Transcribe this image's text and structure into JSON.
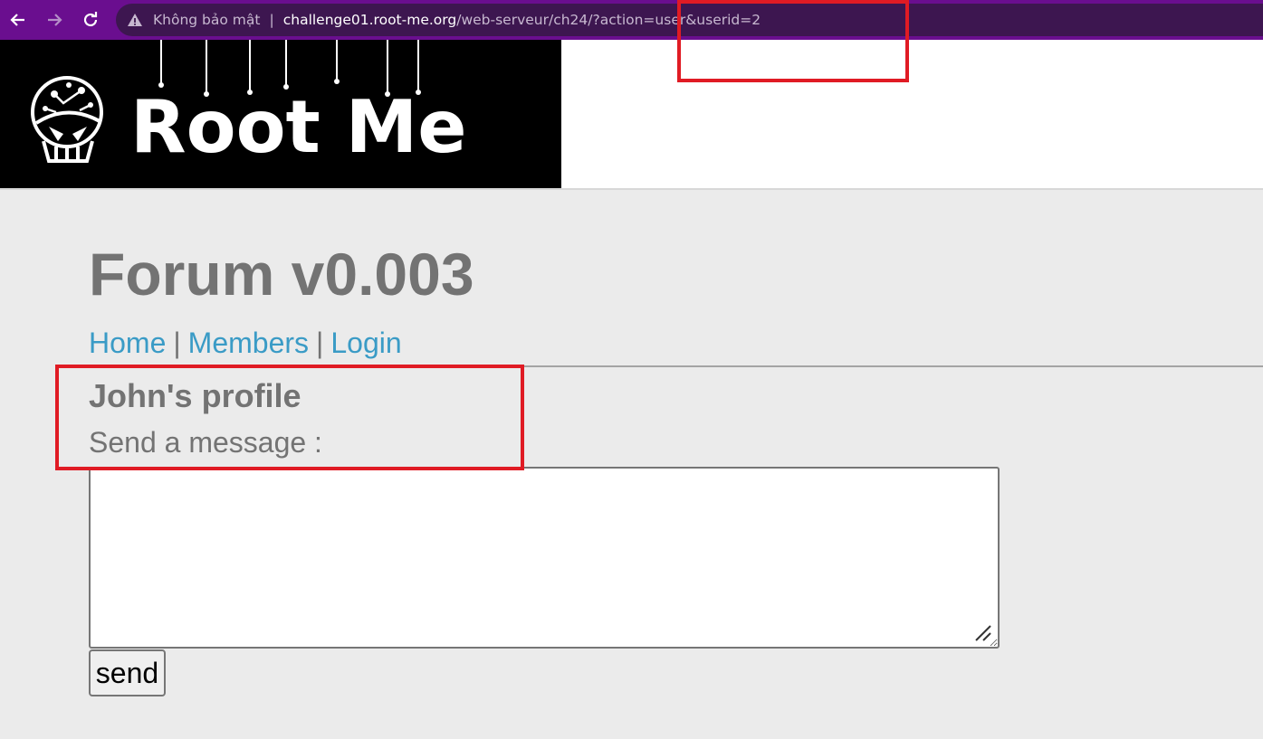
{
  "browser": {
    "security_label": "Không bảo mật",
    "url_host": "challenge01.root-me.org",
    "url_path": "/web-serveur/ch24/?action=user&userid=2"
  },
  "site": {
    "logo_text": "Root Me"
  },
  "forum": {
    "title": "Forum v0.003",
    "nav": {
      "home": "Home",
      "members": "Members",
      "login": "Login",
      "separator": "|"
    },
    "profile_title": "John's profile",
    "send_label": "Send a message :",
    "message_value": "",
    "send_button": "send"
  },
  "colors": {
    "browser_bar": "#6a0e8f",
    "link": "#3a9bc6",
    "text_gray": "#737373",
    "annotation": "#e01b24"
  }
}
